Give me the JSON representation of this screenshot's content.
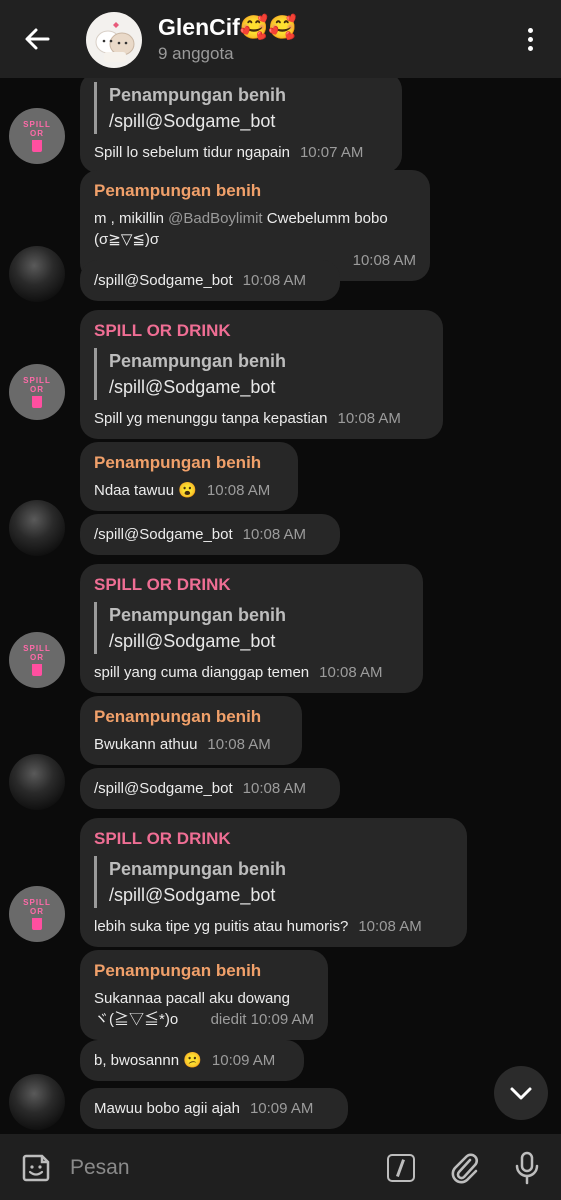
{
  "header": {
    "title": "GlenCif🥰🥰",
    "subtitle": "9 anggota"
  },
  "avatars": {
    "bot_line1": "SPILL",
    "bot_line2": "OR"
  },
  "messages": [
    {
      "quote_title": "Penampungan benih",
      "quote_text": "/spill@Sodgame_bot",
      "text": "Spill lo sebelum tidur ngapain",
      "time": "10:07 AM"
    },
    {
      "sender": "Penampungan benih",
      "text_pre": "m , mikillin ",
      "mention": "@BadBoylimit",
      "text_post": " Cwebelumm bobo (σ≧▽≦)σ",
      "time": "10:08 AM"
    },
    {
      "text": "/spill@Sodgame_bot",
      "time": "10:08 AM"
    },
    {
      "sender": "SPILL OR DRINK",
      "quote_title": "Penampungan benih",
      "quote_text": "/spill@Sodgame_bot",
      "text": "Spill yg menunggu tanpa kepastian",
      "time": "10:08 AM"
    },
    {
      "sender": "Penampungan benih",
      "text": "Ndaa tawuu 😮",
      "time": "10:08 AM"
    },
    {
      "text": "/spill@Sodgame_bot",
      "time": "10:08 AM"
    },
    {
      "sender": "SPILL OR DRINK",
      "quote_title": "Penampungan benih",
      "quote_text": "/spill@Sodgame_bot",
      "text": "spill yang cuma dianggap temen",
      "time": "10:08 AM"
    },
    {
      "sender": "Penampungan benih",
      "text": "Bwukann athuu",
      "time": "10:08 AM"
    },
    {
      "text": "/spill@Sodgame_bot",
      "time": "10:08 AM"
    },
    {
      "sender": "SPILL OR DRINK",
      "quote_title": "Penampungan benih",
      "quote_text": "/spill@Sodgame_bot",
      "text": "lebih suka tipe yg puitis atau humoris?",
      "time": "10:08 AM"
    },
    {
      "sender": "Penampungan benih",
      "text_line1": "Sukannaa pacall aku dowang",
      "text_line2": "ヾ(≧▽≦*)o",
      "time": "diedit 10:09 AM"
    },
    {
      "text": "b, bwosannn 😕",
      "time": "10:09 AM"
    },
    {
      "text": "Mawuu bobo agii ajah",
      "time": "10:09 AM"
    }
  ],
  "input": {
    "placeholder": "Pesan"
  },
  "colors": {
    "header_bg": "#212121",
    "chat_bg": "#0b0b0b",
    "bubble_bg": "#272727",
    "bot_name": "#ef6e94",
    "user_name": "#f0a06a"
  }
}
